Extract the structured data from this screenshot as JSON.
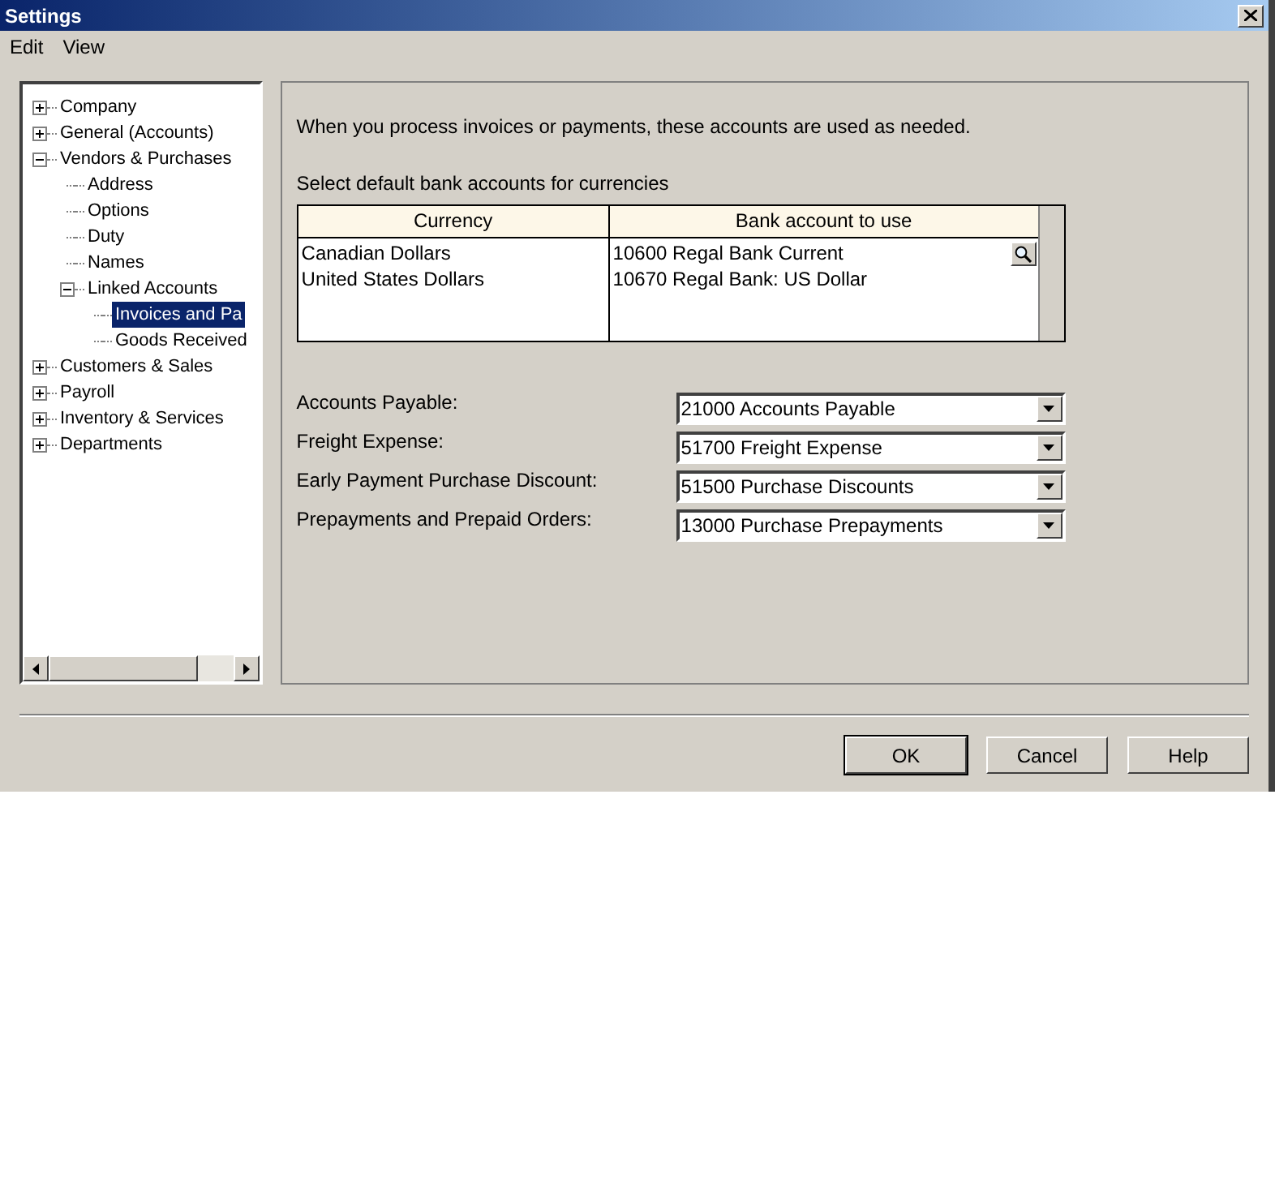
{
  "window": {
    "title": "Settings"
  },
  "menu": [
    "Edit",
    "View"
  ],
  "tree": [
    {
      "label": "Company",
      "expanded": false,
      "selected": false
    },
    {
      "label": "General (Accounts)",
      "expanded": false,
      "selected": false
    },
    {
      "label": "Vendors & Purchases",
      "expanded": true,
      "selected": false,
      "children": [
        {
          "label": "Address",
          "selected": false
        },
        {
          "label": "Options",
          "selected": false
        },
        {
          "label": "Duty",
          "selected": false
        },
        {
          "label": "Names",
          "selected": false
        },
        {
          "label": "Linked Accounts",
          "expanded": true,
          "selected": false,
          "children": [
            {
              "label": "Invoices and Pa",
              "selected": true
            },
            {
              "label": "Goods Received",
              "selected": false
            }
          ]
        }
      ]
    },
    {
      "label": "Customers & Sales",
      "expanded": false,
      "selected": false
    },
    {
      "label": "Payroll",
      "expanded": false,
      "selected": false
    },
    {
      "label": "Inventory & Services",
      "expanded": false,
      "selected": false
    },
    {
      "label": "Departments",
      "expanded": false,
      "selected": false
    }
  ],
  "intro": "When you process invoices or payments, these accounts are used as needed.",
  "bank_section": {
    "label": "Select default bank accounts for currencies",
    "columns": [
      "Currency",
      "Bank account to use"
    ],
    "rows": [
      [
        "Canadian Dollars",
        "10600 Regal Bank Current"
      ],
      [
        "United States Dollars",
        "10670 Regal Bank: US Dollar"
      ]
    ]
  },
  "accounts": [
    {
      "label": "Accounts Payable:",
      "value": "21000 Accounts Payable"
    },
    {
      "label": "Freight Expense:",
      "value": "51700 Freight Expense"
    },
    {
      "label": "Early Payment Purchase Discount:",
      "value": "51500 Purchase Discounts"
    },
    {
      "label": "Prepayments and Prepaid Orders:",
      "value": "13000 Purchase Prepayments"
    }
  ],
  "buttons": [
    "OK",
    "Cancel",
    "Help"
  ]
}
